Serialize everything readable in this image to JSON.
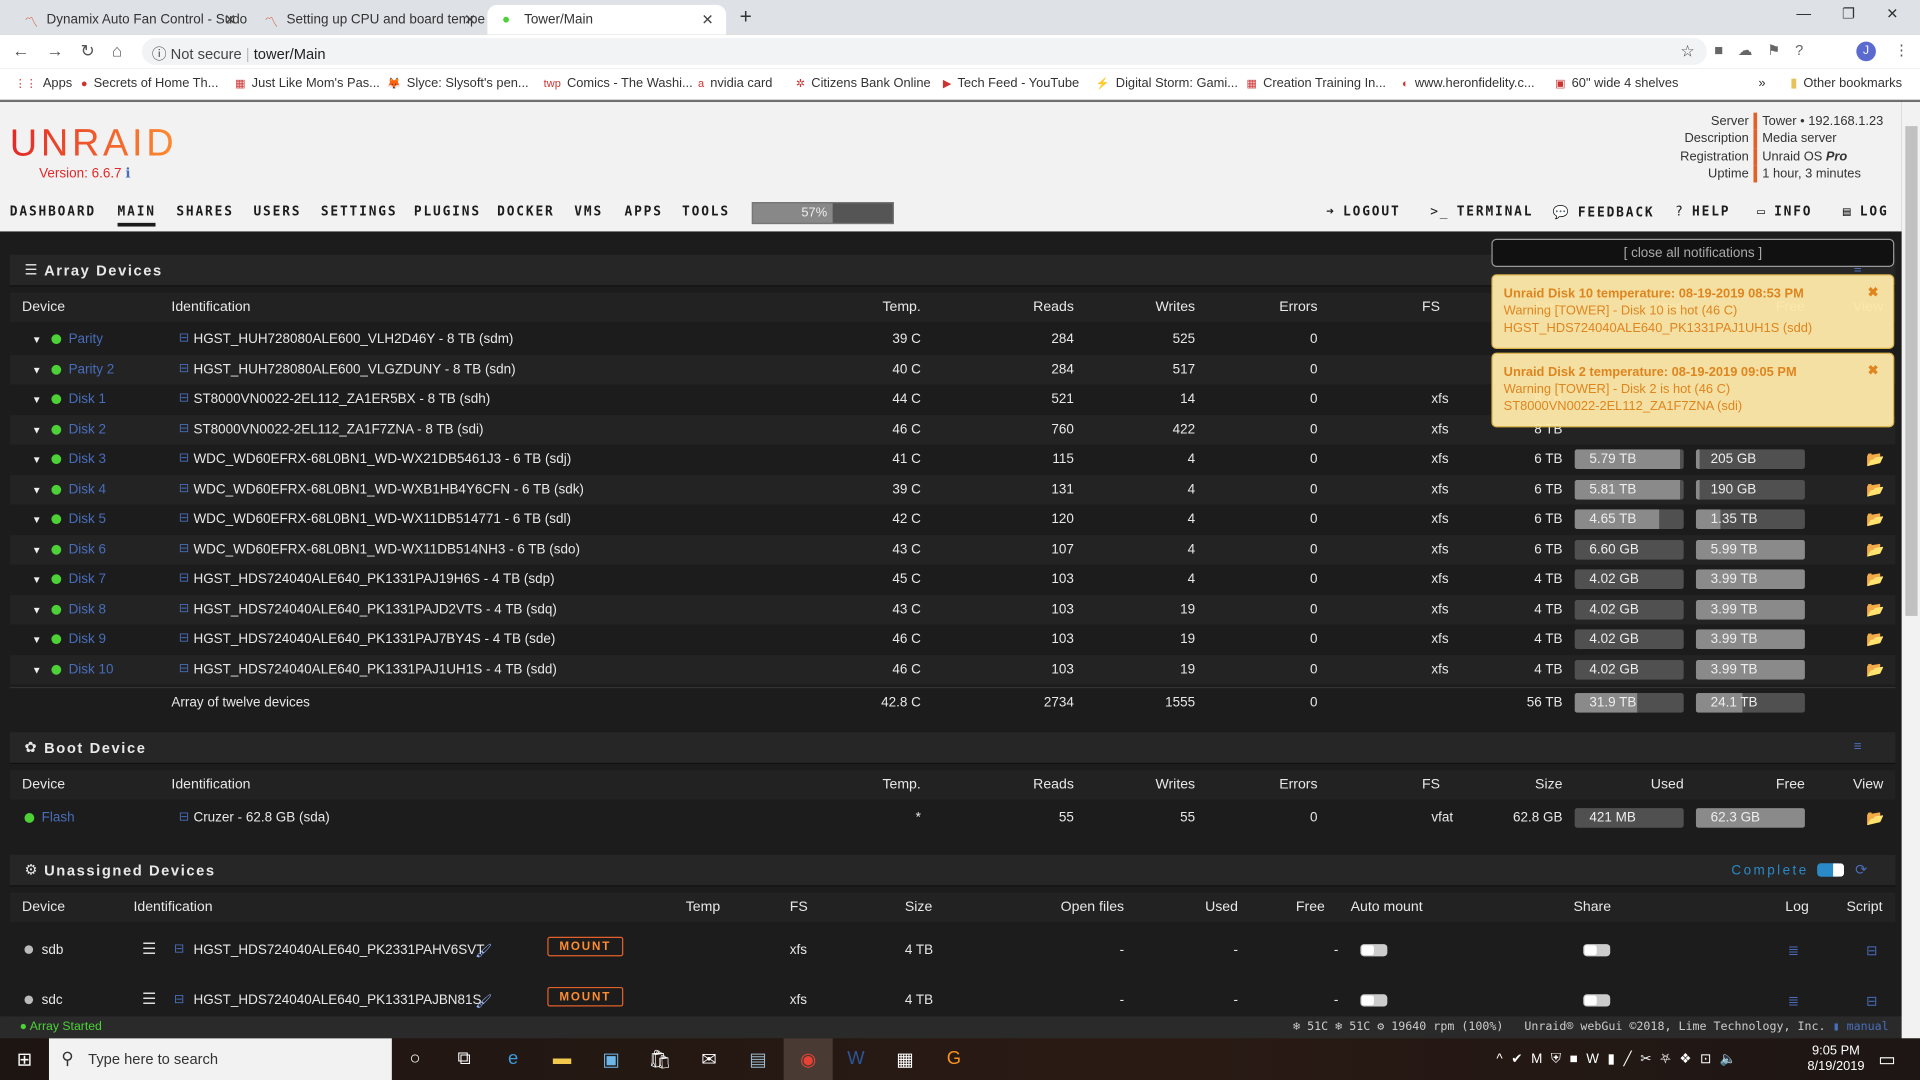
{
  "browser": {
    "tabs": [
      {
        "title": "Dynamix Auto Fan Control - Sudo"
      },
      {
        "title": "Setting up CPU and board tempe"
      },
      {
        "title": "Tower/Main",
        "active": true
      }
    ],
    "security": "Not secure",
    "url": "tower/Main",
    "bookmarks": [
      "Apps",
      "Secrets of Home Th...",
      "Just Like Mom's Pas...",
      "Slyce: Slysoft's pen...",
      "Comics - The Washi...",
      "nvidia card",
      "Citizens Bank Online",
      "Tech Feed - YouTube",
      "Digital Storm: Gami...",
      "Creation Training In...",
      "www.heronfidelity.c...",
      "60\" wide 4 shelves"
    ],
    "other_bookmarks": "Other bookmarks"
  },
  "header": {
    "logo": "UNRAID",
    "version": "Version: 6.6.7",
    "nav": [
      "DASHBOARD",
      "MAIN",
      "SHARES",
      "USERS",
      "SETTINGS",
      "PLUGINS",
      "DOCKER",
      "VMS",
      "APPS",
      "TOOLS"
    ],
    "active_nav": "MAIN",
    "cpu_load_pct": 57,
    "cpu_label": "57%",
    "actions": [
      "LOGOUT",
      "TERMINAL",
      "FEEDBACK",
      "HELP",
      "INFO",
      "LOG"
    ],
    "server": {
      "Server": "Tower • 192.168.1.23",
      "Description": "Media server",
      "Registration": "Unraid OS Pro",
      "Uptime": "1 hour, 3 minutes"
    }
  },
  "array": {
    "title": "Array Devices",
    "columns": [
      "Device",
      "Identification",
      "Temp.",
      "Reads",
      "Writes",
      "Errors",
      "FS",
      "Size",
      "Used",
      "Free",
      "View"
    ],
    "rows": [
      {
        "device": "Parity",
        "id": "HGST_HUH728080ALE600_VLH2D46Y - 8 TB (sdm)",
        "temp": "39 C",
        "reads": "284",
        "writes": "525",
        "errors": "0",
        "fs": "",
        "size": "",
        "used": "",
        "free": ""
      },
      {
        "device": "Parity 2",
        "id": "HGST_HUH728080ALE600_VLGZDUNY - 8 TB (sdn)",
        "temp": "40 C",
        "reads": "284",
        "writes": "517",
        "errors": "0",
        "fs": "",
        "size": "",
        "used": "",
        "free": ""
      },
      {
        "device": "Disk 1",
        "id": "ST8000VN0022-2EL112_ZA1ER5BX - 8 TB (sdh)",
        "temp": "44 C",
        "reads": "521",
        "writes": "14",
        "errors": "0",
        "fs": "xfs",
        "size": "8 TB",
        "used": "",
        "free": ""
      },
      {
        "device": "Disk 2",
        "id": "ST8000VN0022-2EL112_ZA1F7ZNA - 8 TB (sdi)",
        "temp": "46 C",
        "reads": "760",
        "writes": "422",
        "errors": "0",
        "fs": "xfs",
        "size": "8 TB",
        "used": "",
        "free": ""
      },
      {
        "device": "Disk 3",
        "id": "WDC_WD60EFRX-68L0BN1_WD-WX21DB5461J3 - 6 TB (sdj)",
        "temp": "41 C",
        "reads": "115",
        "writes": "4",
        "errors": "0",
        "fs": "xfs",
        "size": "6 TB",
        "used": "5.79 TB",
        "free": "205 GB",
        "used_frac": 0.97,
        "free_frac": 0.03
      },
      {
        "device": "Disk 4",
        "id": "WDC_WD60EFRX-68L0BN1_WD-WXB1HB4Y6CFN - 6 TB (sdk)",
        "temp": "39 C",
        "reads": "131",
        "writes": "4",
        "errors": "0",
        "fs": "xfs",
        "size": "6 TB",
        "used": "5.81 TB",
        "free": "190 GB",
        "used_frac": 0.97,
        "free_frac": 0.03
      },
      {
        "device": "Disk 5",
        "id": "WDC_WD60EFRX-68L0BN1_WD-WX11DB514771 - 6 TB (sdl)",
        "temp": "42 C",
        "reads": "120",
        "writes": "4",
        "errors": "0",
        "fs": "xfs",
        "size": "6 TB",
        "used": "4.65 TB",
        "free": "1.35 TB",
        "used_frac": 0.78,
        "free_frac": 0.22
      },
      {
        "device": "Disk 6",
        "id": "WDC_WD60EFRX-68L0BN1_WD-WX11DB514NH3 - 6 TB (sdo)",
        "temp": "43 C",
        "reads": "107",
        "writes": "4",
        "errors": "0",
        "fs": "xfs",
        "size": "6 TB",
        "used": "6.60 GB",
        "free": "5.99 TB",
        "used_frac": 0.0,
        "free_frac": 1.0
      },
      {
        "device": "Disk 7",
        "id": "HGST_HDS724040ALE640_PK1331PAJ19H6S - 4 TB (sdp)",
        "temp": "45 C",
        "reads": "103",
        "writes": "4",
        "errors": "0",
        "fs": "xfs",
        "size": "4 TB",
        "used": "4.02 GB",
        "free": "3.99 TB",
        "used_frac": 0.0,
        "free_frac": 1.0
      },
      {
        "device": "Disk 8",
        "id": "HGST_HDS724040ALE640_PK1331PAJD2VTS - 4 TB (sdq)",
        "temp": "43 C",
        "reads": "103",
        "writes": "19",
        "errors": "0",
        "fs": "xfs",
        "size": "4 TB",
        "used": "4.02 GB",
        "free": "3.99 TB",
        "used_frac": 0.0,
        "free_frac": 1.0
      },
      {
        "device": "Disk 9",
        "id": "HGST_HDS724040ALE640_PK1331PAJ7BY4S - 4 TB (sde)",
        "temp": "46 C",
        "reads": "103",
        "writes": "19",
        "errors": "0",
        "fs": "xfs",
        "size": "4 TB",
        "used": "4.02 GB",
        "free": "3.99 TB",
        "used_frac": 0.0,
        "free_frac": 1.0
      },
      {
        "device": "Disk 10",
        "id": "HGST_HDS724040ALE640_PK1331PAJ1UH1S - 4 TB (sdd)",
        "temp": "46 C",
        "reads": "103",
        "writes": "19",
        "errors": "0",
        "fs": "xfs",
        "size": "4 TB",
        "used": "4.02 GB",
        "free": "3.99 TB",
        "used_frac": 0.0,
        "free_frac": 1.0
      }
    ],
    "summary": {
      "label": "Array of twelve devices",
      "temp": "42.8 C",
      "reads": "2734",
      "writes": "1555",
      "errors": "0",
      "size": "56 TB",
      "used": "31.9 TB",
      "free": "24.1 TB",
      "used_frac": 0.57,
      "free_frac": 0.43
    }
  },
  "boot": {
    "title": "Boot Device",
    "columns": [
      "Device",
      "Identification",
      "Temp.",
      "Reads",
      "Writes",
      "Errors",
      "FS",
      "Size",
      "Used",
      "Free",
      "View"
    ],
    "row": {
      "device": "Flash",
      "id": "Cruzer - 62.8 GB (sda)",
      "temp": "*",
      "reads": "55",
      "writes": "55",
      "errors": "0",
      "fs": "vfat",
      "size": "62.8 GB",
      "used": "421 MB",
      "free": "62.3 GB",
      "used_frac": 0.0,
      "free_frac": 1.0
    }
  },
  "unassigned": {
    "title": "Unassigned Devices",
    "complete_label": "Complete",
    "columns": [
      "Device",
      "Identification",
      "Temp",
      "FS",
      "Size",
      "Open files",
      "Used",
      "Free",
      "Auto mount",
      "Share",
      "Log",
      "Script"
    ],
    "rows": [
      {
        "device": "sdb",
        "id": "HGST_HDS724040ALE640_PK2331PAHV6SVT",
        "mount": "MOUNT",
        "fs": "xfs",
        "size": "4 TB",
        "open": "-",
        "used": "-",
        "free": "-"
      },
      {
        "device": "sdc",
        "id": "HGST_HDS724040ALE640_PK1331PAJBN81S",
        "mount": "MOUNT",
        "fs": "xfs",
        "size": "4 TB",
        "open": "-",
        "used": "-",
        "free": "-"
      }
    ]
  },
  "notifications": {
    "close_all": "[ close all notifications ]",
    "items": [
      {
        "title": "Unraid Disk 10 temperature: 08-19-2019 08:53 PM",
        "line1": "Warning [TOWER] - Disk 10 is hot (46 C)",
        "line2": "HGST_HDS724040ALE640_PK1331PAJ1UH1S (sdd)"
      },
      {
        "title": "Unraid Disk 2 temperature: 08-19-2019 09:05 PM",
        "line1": "Warning [TOWER] - Disk 2 is hot (46 C)",
        "line2": "ST8000VN0022-2EL112_ZA1F7ZNA (sdi)"
      }
    ]
  },
  "statusbar": {
    "array_status": "Array Started",
    "temp1": "51C",
    "temp2": "51C",
    "fan": "19640 rpm (100%)",
    "copyright": "Unraid® webGui ©2018, Lime Technology, Inc.",
    "manual": "manual"
  },
  "taskbar": {
    "search_placeholder": "Type here to search",
    "time": "9:05 PM",
    "date": "8/19/2019"
  },
  "colors": {
    "accent": "#e2602a",
    "link": "#486dba",
    "status_ok": "#4cd137",
    "notification_bg": "#fee8a9"
  }
}
